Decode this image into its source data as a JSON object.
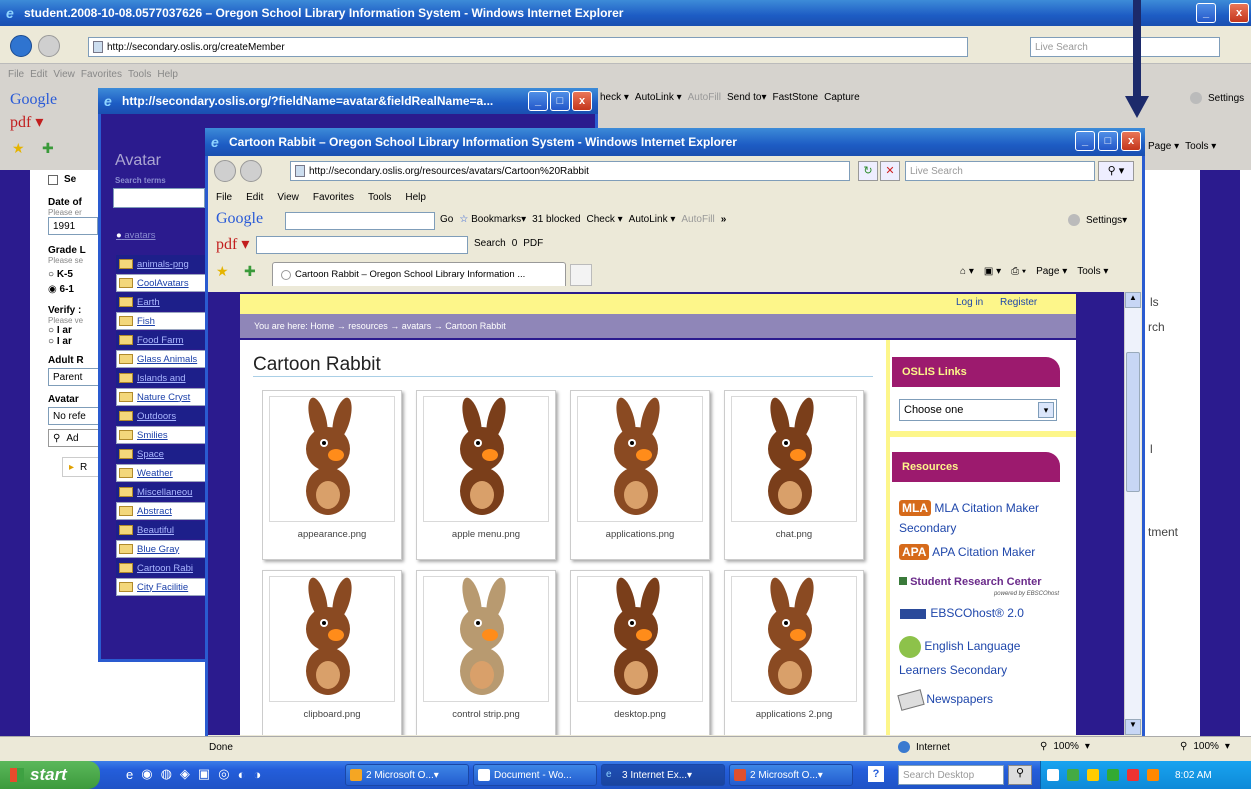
{
  "outer_window": {
    "title": "student.2008-10-08.0577037626 – Oregon School Library Information System - Windows Internet Explorer",
    "address": "http://secondary.oslis.org/createMember",
    "search_placeholder": "Live Search",
    "menu": [
      "File",
      "Edit",
      "View",
      "Favorites",
      "Tools",
      "Help"
    ],
    "toolbar_items": [
      "heck ▾",
      "AutoLink ▾",
      "AutoFill",
      "Send to▾",
      "FastStone",
      "Capture"
    ],
    "settings": "Settings",
    "page_menu": "Page ▾",
    "tools_menu": "Tools ▾",
    "form": {
      "checkbox_label": "Se",
      "dob_label": "Date of",
      "dob_hint": "Please er",
      "year_value": "1991",
      "grade_label": "Grade L",
      "grade_hint": "Please se",
      "grade_opt1": "K-5",
      "grade_opt2": "6-1",
      "verify_label": "Verify :",
      "verify_hint": "Please ve",
      "verify_opt1": "I ar",
      "verify_opt2": "I ar",
      "adult_label": "Adult R",
      "adult_value": "Parent",
      "avatar_label": "Avatar",
      "avatar_value": "No refe",
      "add_button": "Ad",
      "r_button": "R"
    },
    "right_links": [
      "ls",
      "rch",
      "l",
      "tment"
    ],
    "status_zoom": "100%"
  },
  "popup_window": {
    "title": "http://secondary.oslis.org/?fieldName=avatar&fieldRealName=a...",
    "heading": "Avatar",
    "search_terms_label": "Search terms",
    "root_folder": "avatars",
    "folders": [
      {
        "label": "animals-png",
        "dark": true
      },
      {
        "label": "CoolAvatars",
        "dark": false
      },
      {
        "label": "Earth",
        "dark": true
      },
      {
        "label": "Fish",
        "dark": false
      },
      {
        "label": "Food Farm",
        "dark": true
      },
      {
        "label": "Glass Animals",
        "dark": false
      },
      {
        "label": "Islands and",
        "dark": true
      },
      {
        "label": "Nature Cryst",
        "dark": false
      },
      {
        "label": "Outdoors",
        "dark": true
      },
      {
        "label": "Smilies",
        "dark": false
      },
      {
        "label": "Space",
        "dark": true
      },
      {
        "label": "Weather",
        "dark": false
      },
      {
        "label": "Miscellaneou",
        "dark": true
      },
      {
        "label": "Abstract",
        "dark": false
      },
      {
        "label": "Beautiful",
        "dark": true
      },
      {
        "label": "Blue Gray",
        "dark": false
      },
      {
        "label": "Cartoon Rabi",
        "dark": true
      },
      {
        "label": "City Facilitie",
        "dark": false
      }
    ]
  },
  "main_window": {
    "title": "Cartoon Rabbit – Oregon School Library Information System - Windows Internet Explorer",
    "address": "http://secondary.oslis.org/resources/avatars/Cartoon%20Rabbit",
    "search_placeholder": "Live Search",
    "menu": [
      "File",
      "Edit",
      "View",
      "Favorites",
      "Tools",
      "Help"
    ],
    "google_toolbar": {
      "go": "Go",
      "bookmarks": "Bookmarks▾",
      "blocked": "31 blocked",
      "check": "Check ▾",
      "autolink": "AutoLink ▾",
      "autofill": "AutoFill",
      "more": "»",
      "settings": "Settings▾"
    },
    "pdf_toolbar": {
      "pdf": "pdf ▾",
      "search": "Search",
      "count": "0",
      "pdf_btn": "PDF"
    },
    "tab_label": "Cartoon Rabbit – Oregon School Library Information ...",
    "cmd": {
      "page": "Page ▾",
      "tools": "Tools ▾"
    },
    "login": "Log in",
    "register": "Register",
    "breadcrumb": "You are here: Home → resources → avatars → Cartoon Rabbit",
    "page_title": "Cartoon Rabbit",
    "tiles": [
      "appearance.png",
      "apple menu.png",
      "applications.png",
      "chat.png",
      "clipboard.png",
      "control strip.png",
      "desktop.png",
      "applications 2.png"
    ],
    "sidebar": {
      "links_title": "OSLIS Links",
      "select_value": "Choose one",
      "resources_title": "Resources",
      "mla": "MLA Citation Maker Secondary",
      "apa": "APA Citation Maker",
      "src": "Student Research Center",
      "src_sub": "powered by EBSCOhost",
      "ebsco": "EBSCOhost® 2.0",
      "ell": "English Language Learners Secondary",
      "news": "Newspapers"
    },
    "status": "Done",
    "zone": "Internet",
    "zoom": "100%"
  },
  "taskbar": {
    "start": "start",
    "buttons": [
      "2 Microsoft O...",
      "Document - Wo...",
      "3 Internet Ex...",
      "2 Microsoft O..."
    ],
    "search_placeholder": "Search Desktop",
    "clock": "8:02 AM"
  },
  "colors": {
    "title_blue": "#1d5cc4",
    "oslis_purple": "#2b1b8e",
    "magenta": "#9c1a6e",
    "yellow_bar": "#fdf68a",
    "taskbar": "#245edb",
    "start_green": "#3c9a3c"
  }
}
